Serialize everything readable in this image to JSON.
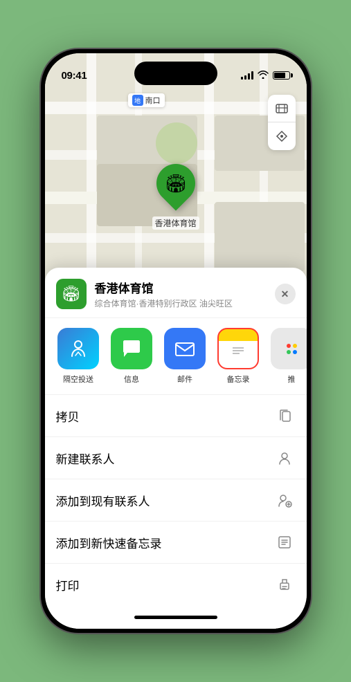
{
  "status_bar": {
    "time": "09:41",
    "signal_label": "signal",
    "wifi_label": "wifi",
    "battery_label": "battery"
  },
  "map": {
    "location_label": "南口",
    "venue_marker_label": "香港体育馆",
    "controls": {
      "map_type": "🗺",
      "location": "↗"
    }
  },
  "bottom_sheet": {
    "venue_name": "香港体育馆",
    "venue_subtitle": "综合体育馆·香港特别行政区 油尖旺区",
    "close_label": "✕",
    "share_items": [
      {
        "id": "airdrop",
        "label": "隔空投送",
        "type": "airdrop"
      },
      {
        "id": "messages",
        "label": "信息",
        "type": "messages"
      },
      {
        "id": "mail",
        "label": "邮件",
        "type": "mail"
      },
      {
        "id": "notes",
        "label": "备忘录",
        "type": "notes",
        "selected": true
      }
    ],
    "more_label": "推",
    "actions": [
      {
        "id": "copy",
        "label": "拷贝",
        "icon": "copy"
      },
      {
        "id": "new-contact",
        "label": "新建联系人",
        "icon": "person"
      },
      {
        "id": "add-existing",
        "label": "添加到现有联系人",
        "icon": "person-add"
      },
      {
        "id": "add-notes",
        "label": "添加到新快速备忘录",
        "icon": "note"
      },
      {
        "id": "print",
        "label": "打印",
        "icon": "print"
      }
    ]
  }
}
